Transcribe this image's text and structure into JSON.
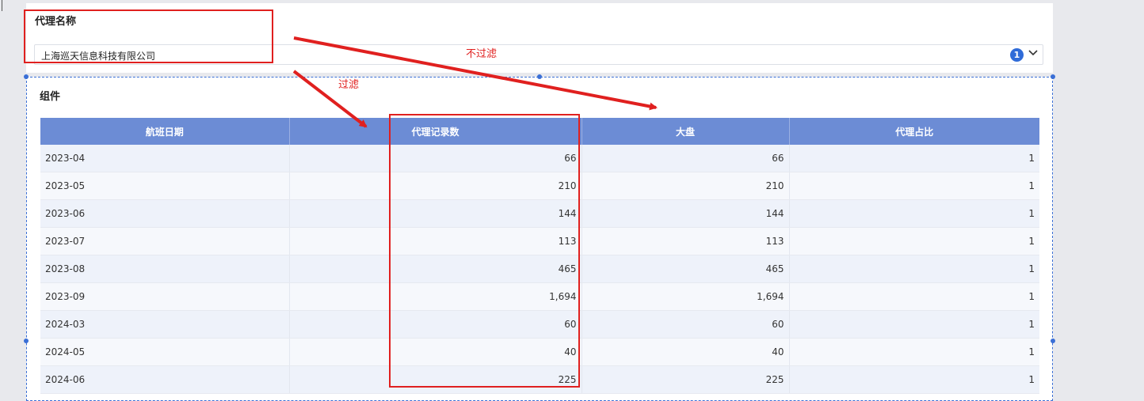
{
  "filter": {
    "title": "代理名称",
    "selected_value": "上海巡天信息科技有限公司",
    "selected_count": "1",
    "chevron_icon": "chevron-down-icon"
  },
  "component": {
    "title": "组件",
    "columns": [
      "航班日期",
      "代理记录数",
      "大盘",
      "代理占比"
    ],
    "rows": [
      [
        "2023-04",
        "66",
        "66",
        "1"
      ],
      [
        "2023-05",
        "210",
        "210",
        "1"
      ],
      [
        "2023-06",
        "144",
        "144",
        "1"
      ],
      [
        "2023-07",
        "113",
        "113",
        "1"
      ],
      [
        "2023-08",
        "465",
        "465",
        "1"
      ],
      [
        "2023-09",
        "1,694",
        "1,694",
        "1"
      ],
      [
        "2024-03",
        "60",
        "60",
        "1"
      ],
      [
        "2024-05",
        "40",
        "40",
        "1"
      ],
      [
        "2024-06",
        "225",
        "225",
        "1"
      ]
    ]
  },
  "annotations": {
    "no_filter_label": "不过滤",
    "filter_label": "过滤",
    "color": "#e0201f"
  },
  "colors": {
    "header_bg": "#6c8cd5",
    "accent": "#2f6bd8"
  }
}
